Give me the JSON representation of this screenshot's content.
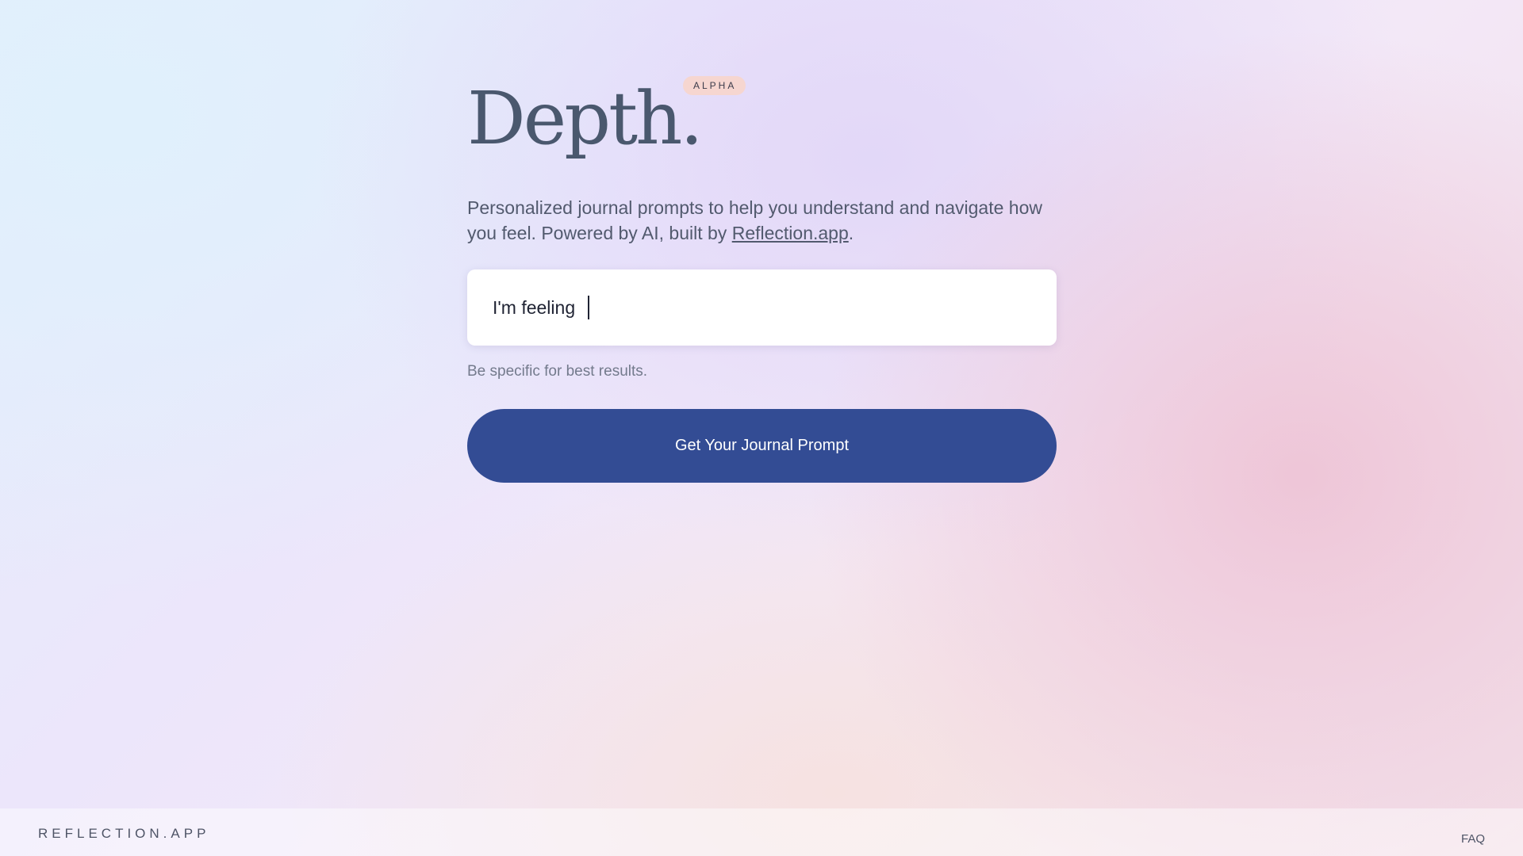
{
  "header": {
    "title": "Depth.",
    "badge": "ALPHA"
  },
  "description": {
    "text_before_link": "Personalized journal prompts to help you understand and navigate how you feel. Powered by AI, built by ",
    "link_text": "Reflection.app",
    "text_after_link": "."
  },
  "feeling_input": {
    "label": "I'm feeling",
    "value": "",
    "placeholder": ""
  },
  "hint": "Be specific for best results.",
  "cta": {
    "label": "Get Your Journal Prompt"
  },
  "footer": {
    "brand": "REFLECTION.APP",
    "faq": "FAQ"
  },
  "colors": {
    "accent": "#334c94",
    "title": "#4a586e",
    "badge_bg": "#f6d6d0"
  }
}
